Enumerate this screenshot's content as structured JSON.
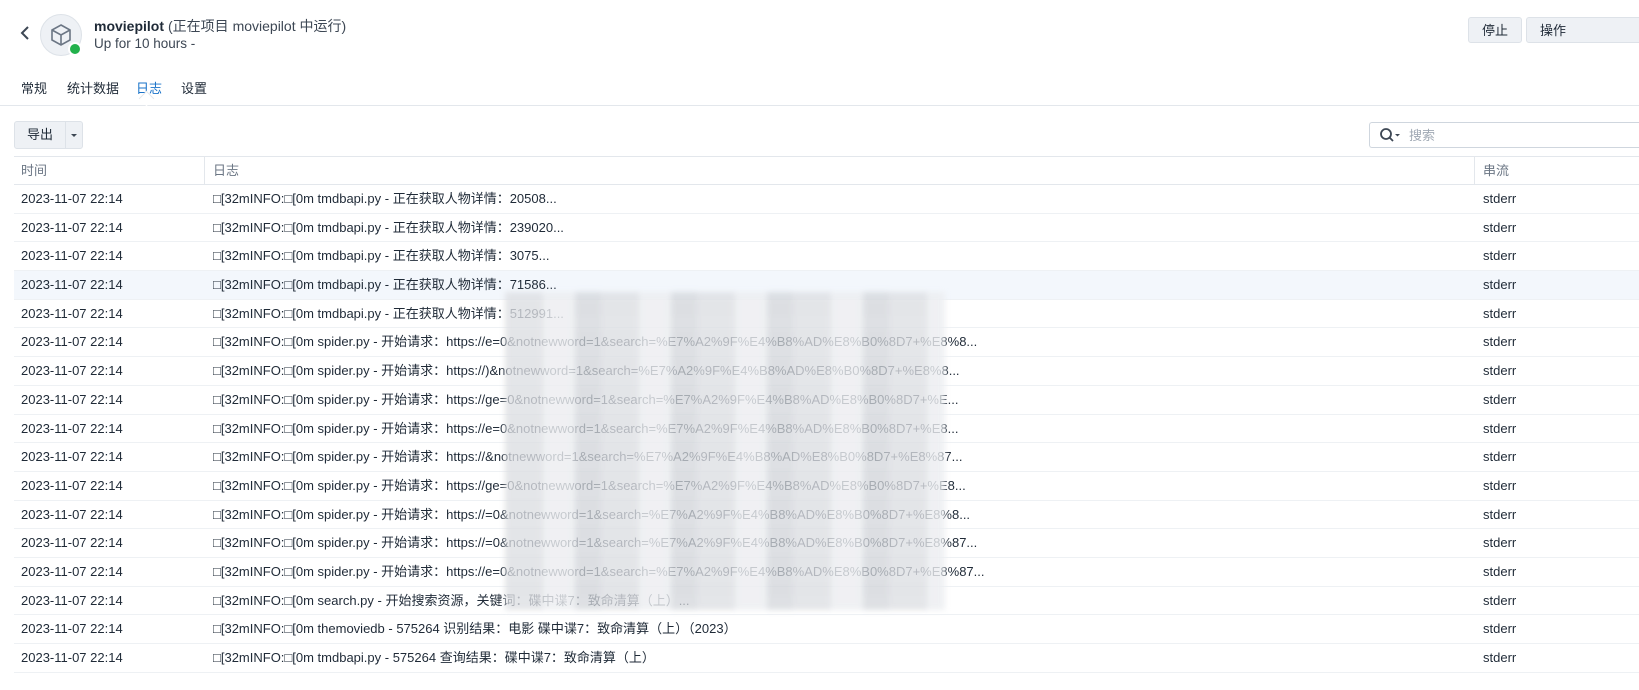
{
  "header": {
    "back_label": "back",
    "app_name": "moviepilot",
    "app_sub": "(正在项目 moviepilot 中运行)",
    "uptime": "Up for 10 hours -",
    "stop_label": "停止",
    "action_label": "操作"
  },
  "tabs": [
    {
      "label": "常规"
    },
    {
      "label": "统计数据"
    },
    {
      "label": "日志"
    },
    {
      "label": "设置"
    }
  ],
  "toolbar": {
    "export_label": "导出",
    "search_placeholder": "搜索"
  },
  "table": {
    "columns": [
      "时间",
      "日志",
      "串流"
    ],
    "rows": [
      {
        "time": "2023-11-07 22:14",
        "log": "□[32mINFO:□[0m tmdbapi.py - 正在获取人物详情：20508...",
        "stream": "stderr"
      },
      {
        "time": "2023-11-07 22:14",
        "log": "□[32mINFO:□[0m tmdbapi.py - 正在获取人物详情：239020...",
        "stream": "stderr"
      },
      {
        "time": "2023-11-07 22:14",
        "log": "□[32mINFO:□[0m tmdbapi.py - 正在获取人物详情：3075...",
        "stream": "stderr"
      },
      {
        "time": "2023-11-07 22:14",
        "log": "□[32mINFO:□[0m tmdbapi.py - 正在获取人物详情：71586...",
        "stream": "stderr"
      },
      {
        "time": "2023-11-07 22:14",
        "log": "□[32mINFO:□[0m tmdbapi.py - 正在获取人物详情：512991...",
        "stream": "stderr"
      },
      {
        "time": "2023-11-07 22:14",
        "log": "□[32mINFO:□[0m spider.py - 开始请求：https://e=0&notnewword=1&search=%E7%A2%9F%E4%B8%AD%E8%B0%8D7+%E8%8...",
        "stream": "stderr"
      },
      {
        "time": "2023-11-07 22:14",
        "log": "□[32mINFO:□[0m spider.py - 开始请求：https://)&notnewword=1&search=%E7%A2%9F%E4%B8%AD%E8%B0%8D7+%E8%8...",
        "stream": "stderr"
      },
      {
        "time": "2023-11-07 22:14",
        "log": "□[32mINFO:□[0m spider.py - 开始请求：https://ge=0&notnewword=1&search=%E7%A2%9F%E4%B8%AD%E8%B0%8D7+%E...",
        "stream": "stderr"
      },
      {
        "time": "2023-11-07 22:14",
        "log": "□[32mINFO:□[0m spider.py - 开始请求：https://e=0&notnewword=1&search=%E7%A2%9F%E4%B8%AD%E8%B0%8D7+%E8...",
        "stream": "stderr"
      },
      {
        "time": "2023-11-07 22:14",
        "log": "□[32mINFO:□[0m spider.py - 开始请求：https://&notnewword=1&search=%E7%A2%9F%E4%B8%AD%E8%B0%8D7+%E8%87...",
        "stream": "stderr"
      },
      {
        "time": "2023-11-07 22:14",
        "log": "□[32mINFO:□[0m spider.py - 开始请求：https://ge=0&notnewword=1&search=%E7%A2%9F%E4%B8%AD%E8%B0%8D7+%E8...",
        "stream": "stderr"
      },
      {
        "time": "2023-11-07 22:14",
        "log": "□[32mINFO:□[0m spider.py - 开始请求：https://=0&notnewword=1&search=%E7%A2%9F%E4%B8%AD%E8%B0%8D7+%E8%8...",
        "stream": "stderr"
      },
      {
        "time": "2023-11-07 22:14",
        "log": "□[32mINFO:□[0m spider.py - 开始请求：https://=0&notnewword=1&search=%E7%A2%9F%E4%B8%AD%E8%B0%8D7+%E8%87...",
        "stream": "stderr"
      },
      {
        "time": "2023-11-07 22:14",
        "log": "□[32mINFO:□[0m spider.py - 开始请求：https://e=0&notnewword=1&search=%E7%A2%9F%E4%B8%AD%E8%B0%8D7+%E8%87...",
        "stream": "stderr"
      },
      {
        "time": "2023-11-07 22:14",
        "log": "□[32mINFO:□[0m search.py - 开始搜索资源，关键词：碟中谍7：致命清算（上）...",
        "stream": "stderr"
      },
      {
        "time": "2023-11-07 22:14",
        "log": "□[32mINFO:□[0m themoviedb - 575264 识别结果：电影 碟中谍7：致命清算（上）（2023）",
        "stream": "stderr"
      },
      {
        "time": "2023-11-07 22:14",
        "log": "□[32mINFO:□[0m tmdbapi.py - 575264 查询结果：碟中谍7：致命清算（上）",
        "stream": "stderr"
      }
    ]
  },
  "colors": {
    "accent": "#1a73c9",
    "status_running": "#22b14c"
  }
}
